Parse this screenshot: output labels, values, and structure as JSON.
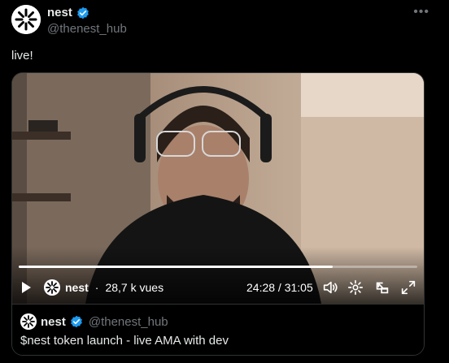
{
  "author": {
    "name": "nest",
    "handle": "@thenest_hub"
  },
  "tweet": {
    "text": "live!"
  },
  "video": {
    "channel_name": "nest",
    "separator": "·",
    "views": "28,7 k vues",
    "time": "24:28 / 31:05",
    "progress": 0.787
  },
  "quote": {
    "name": "nest",
    "handle": "@thenest_hub",
    "text": "$nest token launch - live AMA with dev"
  },
  "colors": {
    "verified": "#1d9bf0",
    "background": "#000000",
    "secondary_text": "#71767b"
  }
}
